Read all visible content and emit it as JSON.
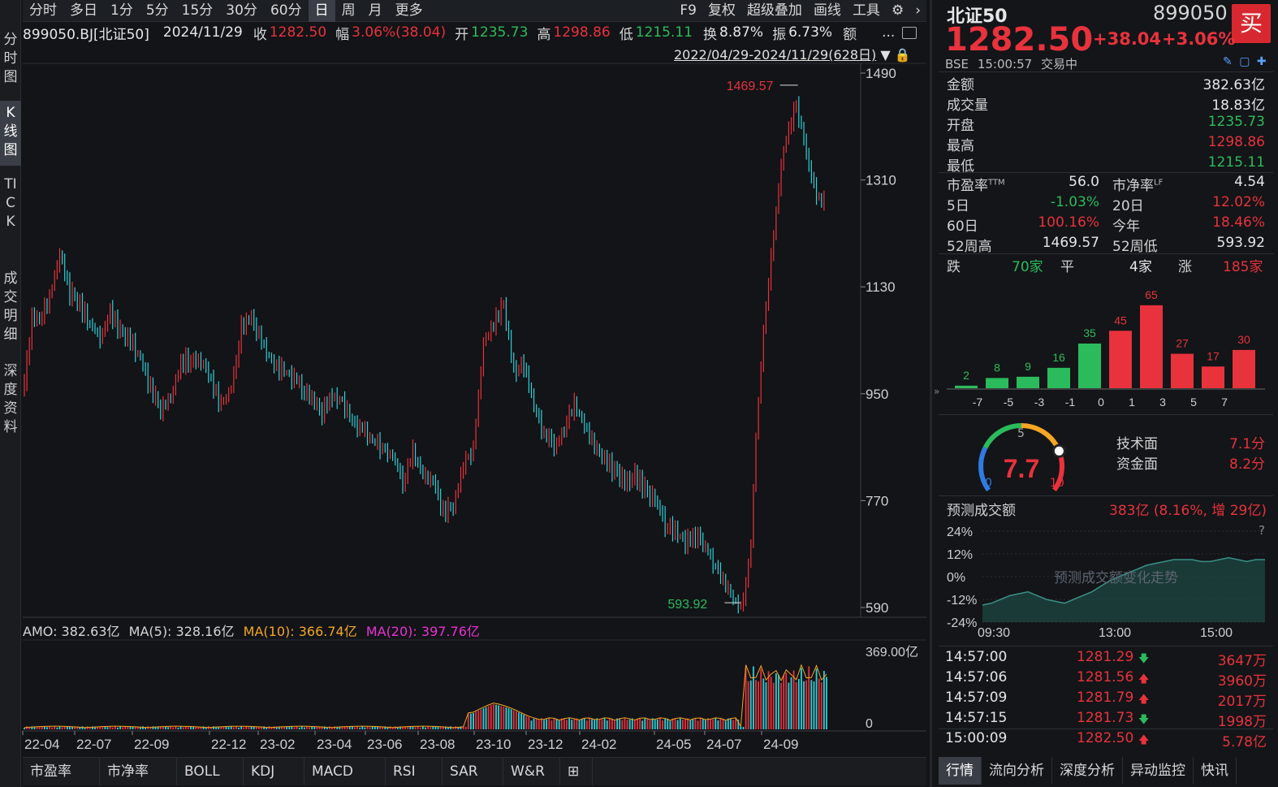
{
  "toolbar": {
    "tabs": [
      "分时",
      "多日",
      "1分",
      "5分",
      "15分",
      "30分",
      "60分",
      "日",
      "周",
      "月",
      "更多"
    ],
    "active_tab": "日",
    "right_items": [
      "F9",
      "复权",
      "超级叠加",
      "画线",
      "工具"
    ]
  },
  "left_nav": {
    "items": [
      "分时图",
      "K线图",
      "TICK",
      "成交明细",
      "深度资料"
    ],
    "active": "K线图"
  },
  "info": {
    "code": "899050.BJ[北证50]",
    "date": "2024/11/29",
    "close_label": "收",
    "close": "1282.50",
    "change_label": "幅",
    "change": "3.06%(38.04)",
    "open_label": "开",
    "open": "1235.73",
    "high_label": "高",
    "high": "1298.86",
    "low_label": "低",
    "low": "1215.11",
    "turnover_label": "换",
    "turnover": "8.87%",
    "amplitude_label": "振",
    "amplitude": "6.73%",
    "amount_label": "额",
    "more": "..."
  },
  "range_text": "2022/04/29-2024/11/29(628日)",
  "chart_data": {
    "type": "line",
    "price_axis_ticks": [
      "1490",
      "1310",
      "1130",
      "950",
      "770",
      "590"
    ],
    "price_ylim": [
      590,
      1490
    ],
    "x_labels": [
      "22-04",
      "22-07",
      "22-09",
      "22-12",
      "23-02",
      "23-04",
      "23-06",
      "23-08",
      "23-10",
      "23-12",
      "24-02",
      "24-05",
      "24-07",
      "24-09"
    ],
    "high_annotation": "1469.57",
    "low_annotation": "593.92",
    "price_path": [
      [
        0,
        960
      ],
      [
        3,
        1080
      ],
      [
        6,
        1075
      ],
      [
        10,
        1110
      ],
      [
        14,
        1190
      ],
      [
        18,
        1120
      ],
      [
        22,
        1100
      ],
      [
        26,
        1065
      ],
      [
        30,
        1045
      ],
      [
        34,
        1090
      ],
      [
        38,
        1055
      ],
      [
        42,
        1040
      ],
      [
        46,
        1010
      ],
      [
        50,
        960
      ],
      [
        54,
        920
      ],
      [
        58,
        945
      ],
      [
        62,
        1000
      ],
      [
        66,
        1010
      ],
      [
        70,
        1005
      ],
      [
        74,
        975
      ],
      [
        78,
        930
      ],
      [
        82,
        960
      ],
      [
        86,
        1060
      ],
      [
        90,
        1080
      ],
      [
        94,
        1040
      ],
      [
        98,
        1005
      ],
      [
        102,
        990
      ],
      [
        106,
        980
      ],
      [
        110,
        960
      ],
      [
        114,
        940
      ],
      [
        118,
        920
      ],
      [
        122,
        950
      ],
      [
        126,
        940
      ],
      [
        130,
        900
      ],
      [
        134,
        890
      ],
      [
        138,
        870
      ],
      [
        142,
        860
      ],
      [
        146,
        845
      ],
      [
        150,
        800
      ],
      [
        154,
        850
      ],
      [
        158,
        810
      ],
      [
        162,
        800
      ],
      [
        166,
        750
      ],
      [
        170,
        760
      ],
      [
        174,
        830
      ],
      [
        178,
        860
      ],
      [
        182,
        1035
      ],
      [
        186,
        1065
      ],
      [
        190,
        1100
      ],
      [
        194,
        990
      ],
      [
        198,
        1000
      ],
      [
        202,
        930
      ],
      [
        206,
        880
      ],
      [
        210,
        860
      ],
      [
        214,
        890
      ],
      [
        218,
        930
      ],
      [
        222,
        900
      ],
      [
        226,
        860
      ],
      [
        230,
        840
      ],
      [
        234,
        820
      ],
      [
        238,
        800
      ],
      [
        242,
        810
      ],
      [
        246,
        790
      ],
      [
        250,
        770
      ],
      [
        254,
        730
      ],
      [
        258,
        720
      ],
      [
        262,
        700
      ],
      [
        266,
        710
      ],
      [
        270,
        690
      ],
      [
        274,
        660
      ],
      [
        278,
        625
      ],
      [
        282,
        600
      ],
      [
        284,
        595
      ],
      [
        286,
        625
      ],
      [
        288,
        700
      ],
      [
        290,
        880
      ],
      [
        292,
        1000
      ],
      [
        294,
        1100
      ],
      [
        296,
        1180
      ],
      [
        298,
        1260
      ],
      [
        300,
        1340
      ],
      [
        302,
        1380
      ],
      [
        304,
        1410
      ],
      [
        306,
        1440
      ],
      [
        308,
        1400
      ],
      [
        310,
        1350
      ],
      [
        312,
        1310
      ],
      [
        314,
        1290
      ],
      [
        316,
        1270
      ],
      [
        318,
        1282
      ]
    ],
    "amo": {
      "label": "AMO:",
      "value": "382.63亿",
      "ma5_label": "MA(5):",
      "ma5": "328.16亿",
      "ma10_label": "MA(10):",
      "ma10": "366.74亿",
      "ma20_label": "MA(20):",
      "ma20": "397.76亿",
      "axis_ticks": [
        "369.00亿",
        "0"
      ]
    }
  },
  "bottom_tabs": [
    "市盈率",
    "市净率",
    "BOLL",
    "KDJ",
    "MACD",
    "RSI",
    "SAR",
    "W&R"
  ],
  "quote": {
    "name": "北证50",
    "code": "899050",
    "price": "1282.50",
    "change": "+38.04",
    "pct": "+3.06%",
    "exchange": "BSE",
    "time": "15:00:57",
    "status": "交易中",
    "buy_label": "买"
  },
  "stats": [
    {
      "label": "金额",
      "value": "382.63亿",
      "color": "white"
    },
    {
      "label": "成交量",
      "value": "18.83亿",
      "color": "white"
    },
    {
      "label": "开盘",
      "value": "1235.73",
      "color": "green"
    },
    {
      "label": "最高",
      "value": "1298.86",
      "color": "red"
    },
    {
      "label": "最低",
      "value": "1215.11",
      "color": "green"
    }
  ],
  "stats2": [
    {
      "l1": "市盈率",
      "sup1": "TTM",
      "v1": "56.0",
      "c1": "white",
      "l2": "市净率",
      "sup2": "LF",
      "v2": "4.54",
      "c2": "white"
    },
    {
      "l1": "5日",
      "sup1": "",
      "v1": "-1.03%",
      "c1": "green",
      "l2": "20日",
      "sup2": "",
      "v2": "12.02%",
      "c2": "red"
    },
    {
      "l1": "60日",
      "sup1": "",
      "v1": "100.16%",
      "c1": "red",
      "l2": "今年",
      "sup2": "",
      "v2": "18.46%",
      "c2": "red"
    },
    {
      "l1": "52周高",
      "sup1": "",
      "v1": "1469.57",
      "c1": "white",
      "l2": "52周低",
      "sup2": "",
      "v2": "593.92",
      "c2": "white"
    }
  ],
  "breadth": {
    "down_label": "跌",
    "down": "70家",
    "flat_label": "平",
    "flat": "4家",
    "up_label": "涨",
    "up": "185家"
  },
  "dist": {
    "values": [
      2,
      8,
      9,
      16,
      35,
      45,
      65,
      27,
      17,
      30
    ],
    "colors": [
      "#2bbb5c",
      "#2bbb5c",
      "#2bbb5c",
      "#2bbb5c",
      "#2bbb5c",
      "#e8323c",
      "#e8323c",
      "#e8323c",
      "#e8323c",
      "#e8323c"
    ],
    "ticks": [
      "-7",
      "-5",
      "-3",
      "-1",
      "0",
      "1",
      "3",
      "5",
      "7"
    ]
  },
  "gauge": {
    "score": "7.7",
    "min": "0",
    "mid": "5",
    "max": "10",
    "tech_label": "技术面",
    "tech": "7.1分",
    "fund_label": "资金面",
    "fund": "8.2分"
  },
  "forecast": {
    "label": "预测成交额",
    "value": "383亿 (8.16%, 增 29亿)",
    "y_ticks": [
      "24%",
      "12%",
      "0%",
      "-12%",
      "-24%"
    ],
    "x_ticks": [
      "09:30",
      "13:00",
      "15:00"
    ],
    "watermark": "预测成交额变化走势",
    "help": "?",
    "series": [
      -15,
      -14,
      -12,
      -10,
      -9,
      -8,
      -10,
      -12,
      -13,
      -14,
      -12,
      -10,
      -8,
      -5,
      -2,
      0,
      2,
      4,
      6,
      7,
      8,
      9,
      9,
      9,
      8,
      8,
      9,
      10,
      9,
      8,
      9,
      9
    ]
  },
  "ticks": [
    {
      "time": "14:57:00",
      "price": "1281.29",
      "dir": "down",
      "vol": "3647万"
    },
    {
      "time": "14:57:06",
      "price": "1281.56",
      "dir": "up",
      "vol": "3960万"
    },
    {
      "time": "14:57:09",
      "price": "1281.79",
      "dir": "up",
      "vol": "2017万"
    },
    {
      "time": "14:57:15",
      "price": "1281.73",
      "dir": "down",
      "vol": "1998万"
    },
    {
      "time": "15:00:09",
      "price": "1282.50",
      "dir": "up",
      "vol": "5.78亿"
    }
  ],
  "right_tabs": [
    "行情",
    "流向分析",
    "深度分析",
    "异动监控",
    "快讯"
  ],
  "right_active": "行情"
}
